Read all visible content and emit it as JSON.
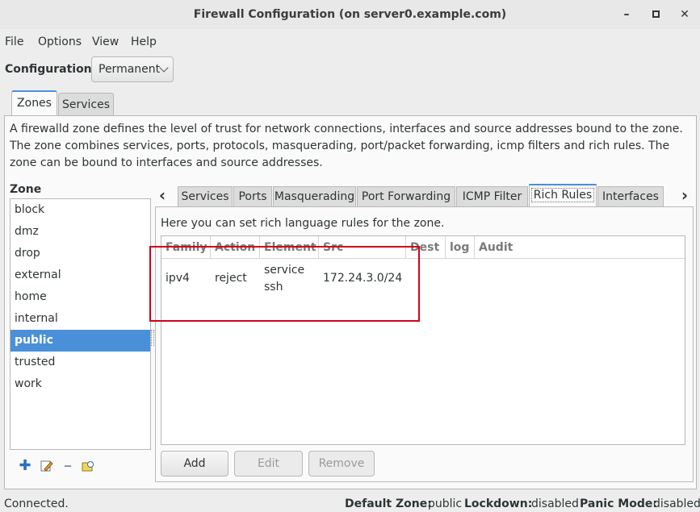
{
  "window": {
    "title": "Firewall Configuration (on server0.example.com)",
    "min_icon": "minimize-icon",
    "max_icon": "maximize-icon",
    "close_icon": "close-icon"
  },
  "menu": [
    "File",
    "Options",
    "View",
    "Help"
  ],
  "configuration": {
    "label": "Configuration:",
    "value": "Permanent"
  },
  "top_tabs": [
    "Zones",
    "Services"
  ],
  "description": "A firewalld zone defines the level of trust for network connections, interfaces and source addresses bound to the zone. The zone combines services, ports, protocols, masquerading, port/packet forwarding, icmp filters and rich rules. The zone can be bound to interfaces and source addresses.",
  "zone": {
    "title": "Zone",
    "items": [
      "block",
      "dmz",
      "drop",
      "external",
      "home",
      "internal",
      "public",
      "trusted",
      "work"
    ],
    "selected": "public",
    "toolbar": [
      "add-icon",
      "edit-icon",
      "remove-icon",
      "load-defaults-icon"
    ]
  },
  "sub_tabs": [
    "Services",
    "Ports",
    "Masquerading",
    "Port Forwarding",
    "ICMP Filter",
    "Rich Rules",
    "Interfaces"
  ],
  "active_sub_tab": "Rich Rules",
  "rich_rules": {
    "description": "Here you can set rich language rules for the zone.",
    "columns": [
      "Family",
      "Action",
      "Element",
      "Src",
      "Dest",
      "log",
      "Audit"
    ],
    "rows": [
      {
        "family": "ipv4",
        "action": "reject",
        "element_1": "service",
        "element_2": "ssh",
        "src": "172.24.3.0/24",
        "dest": "",
        "log": "",
        "audit": ""
      }
    ],
    "buttons": {
      "add": "Add",
      "edit": "Edit",
      "remove": "Remove"
    }
  },
  "status": {
    "connection": "Connected.",
    "default_zone_label": "Default Zone:",
    "default_zone_value": "public",
    "lockdown_label": "Lockdown:",
    "lockdown_value": "disabled",
    "panic_label": "Panic Mode:",
    "panic_value": "disabled"
  },
  "colors": {
    "accent": "#4a90d9",
    "highlight": "#d0021b"
  }
}
